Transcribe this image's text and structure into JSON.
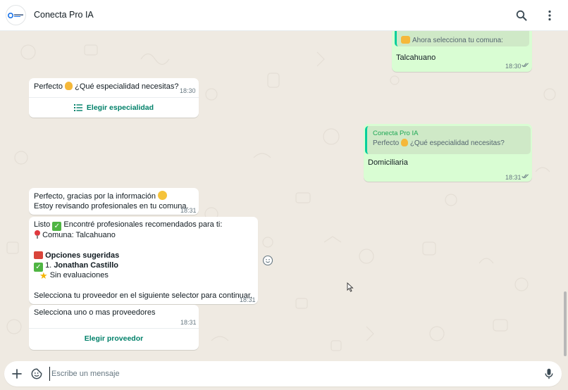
{
  "header": {
    "contact_name": "Conecta Pro IA",
    "icons": [
      "search-icon",
      "menu-dots-icon"
    ]
  },
  "messages": {
    "m1": {
      "direction": "outgoing",
      "quote_text": "Ahora selecciona tu comuna:",
      "text": "Talcahuano",
      "time": "18:30",
      "status": "read"
    },
    "m2": {
      "direction": "incoming",
      "text_before": "Perfecto",
      "text_after": "¿Qué especialidad necesitas?",
      "time": "18:30",
      "button_label": "Elegir especialidad"
    },
    "m3": {
      "direction": "outgoing",
      "quote_author": "Conecta Pro IA",
      "quote_before": "Perfecto",
      "quote_after": "¿Qué especialidad necesitas?",
      "text": "Domiciliaria",
      "time": "18:31",
      "status": "read"
    },
    "m4": {
      "direction": "incoming",
      "line1": "Perfecto, gracias por la información",
      "line2": "Estoy revisando profesionales en tu comuna.",
      "time": "18:31"
    },
    "m5": {
      "direction": "incoming",
      "line1_prefix": "Listo",
      "line1_rest": "Encontré profesionales recomendados para ti:",
      "comuna_line": "Comuna: Talcahuano",
      "section_title": "Opciones sugeridas",
      "item_number": "1.",
      "item_name": "Jonathan Castillo",
      "rating_text": "Sin evaluaciones",
      "footer_text": "Selecciona tu proveedor en el siguiente selector para continuar.",
      "time": "18:31"
    },
    "m6": {
      "direction": "incoming",
      "text": "Selecciona uno o mas proveedores",
      "time": "18:31",
      "button_label": "Elegir proveedor"
    }
  },
  "composer": {
    "placeholder": "Escribe un mensaje",
    "value": ""
  },
  "colors": {
    "incoming_bubble": "#ffffff",
    "outgoing_bubble": "#d9fdd3",
    "accent": "#008069",
    "background": "#efeae2"
  }
}
